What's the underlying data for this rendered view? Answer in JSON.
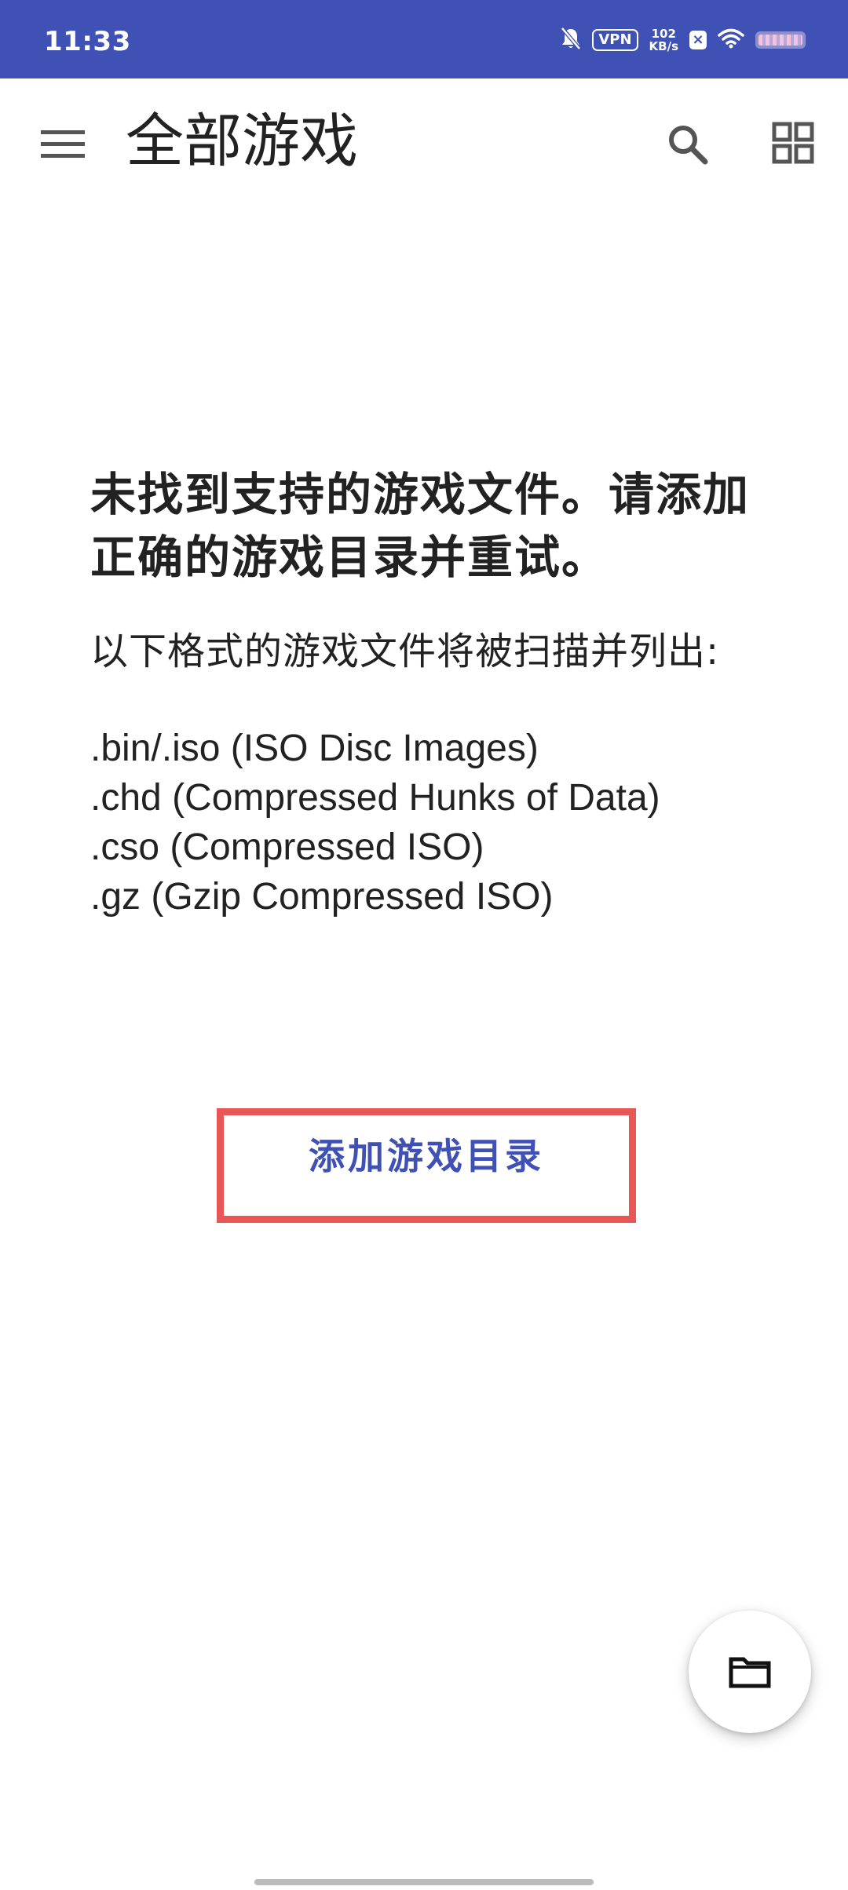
{
  "status_bar": {
    "time": "11:33",
    "vpn": "VPN",
    "speed_value": "102",
    "speed_unit": "KB/s",
    "background": "#3f51b5",
    "icons": [
      "mute-bell-icon",
      "vpn-icon",
      "network-speed",
      "x-badge-icon",
      "wifi-icon",
      "battery-icon"
    ]
  },
  "app_bar": {
    "title": "全部游戏",
    "menu_icon": "menu-icon",
    "search_icon": "search-icon",
    "grid_icon": "grid-view-icon"
  },
  "empty_state": {
    "heading": "未找到支持的游戏文件。请添加正确的游戏目录并重试。",
    "intro": "以下格式的游戏文件将被扫描并列出:",
    "formats": [
      ".bin/.iso (ISO Disc Images)",
      ".chd (Compressed Hunks of Data)",
      ".cso (Compressed ISO)",
      ".gz (Gzip Compressed ISO)"
    ],
    "add_button_label": "添加游戏目录"
  },
  "fab": {
    "icon": "folder-icon"
  },
  "colors": {
    "primary": "#3f51b5",
    "highlight_border": "#e85656",
    "text": "#222222"
  }
}
